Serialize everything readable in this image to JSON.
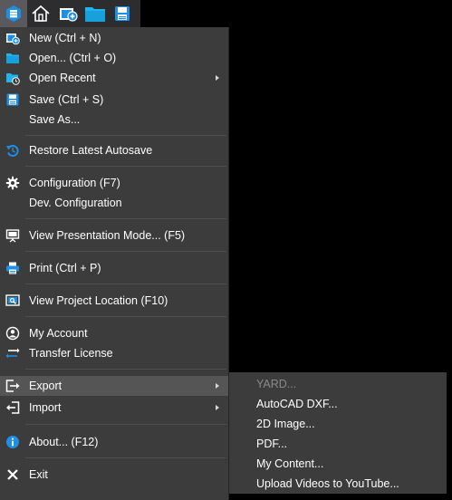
{
  "toolbar": {
    "buttons": [
      {
        "name": "app-menu-icon"
      },
      {
        "name": "home-icon"
      },
      {
        "name": "new-project-icon"
      },
      {
        "name": "open-folder-icon"
      },
      {
        "name": "save-icon"
      }
    ]
  },
  "menu": {
    "new": "New (Ctrl + N)",
    "open": "Open... (Ctrl + O)",
    "open_recent": "Open Recent",
    "save": "Save (Ctrl + S)",
    "save_as": "Save As...",
    "restore": "Restore Latest Autosave",
    "configuration": "Configuration (F7)",
    "dev_configuration": "Dev. Configuration",
    "presentation": "View Presentation Mode... (F5)",
    "print": "Print (Ctrl + P)",
    "project_location": "View Project Location (F10)",
    "my_account": "My Account",
    "transfer_license": "Transfer License",
    "export": "Export",
    "import": "Import",
    "about": "About... (F12)",
    "exit": "Exit"
  },
  "export_submenu": {
    "yard": "YARD...",
    "autocad": "AutoCAD DXF...",
    "image": "2D Image...",
    "pdf": "PDF...",
    "my_content": "My Content...",
    "youtube": "Upload Videos to YouTube..."
  },
  "colors": {
    "accent_blue": "#1e8fe6",
    "menu_bg": "#3c3c3c",
    "highlight_bg": "#555555",
    "disabled_text": "#8a8a8a"
  }
}
